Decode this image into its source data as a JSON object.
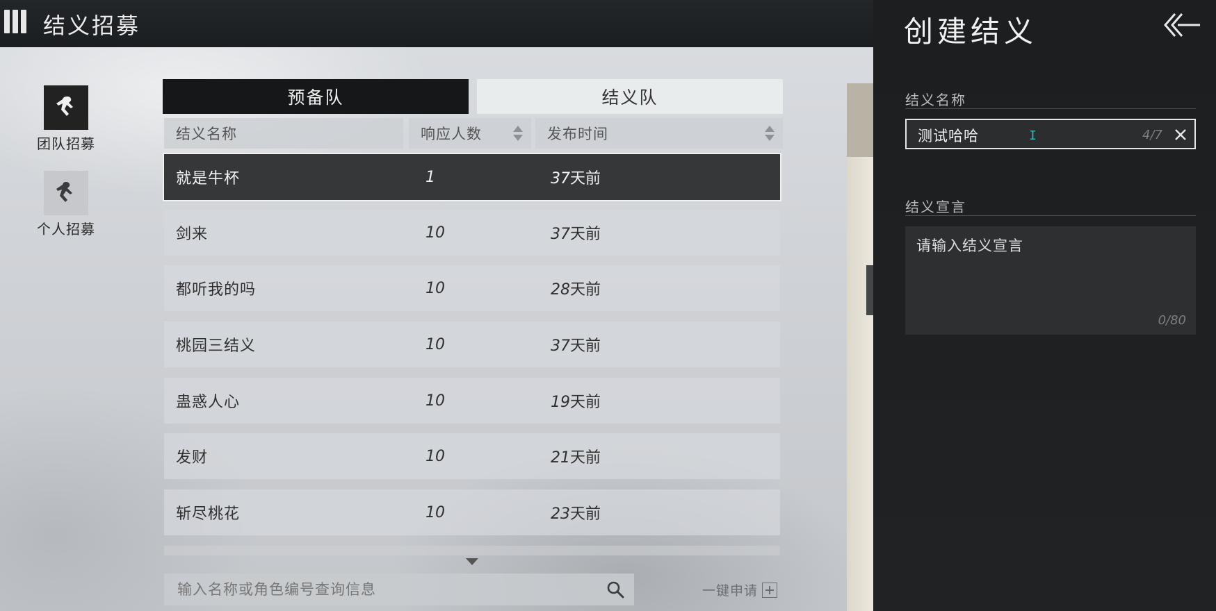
{
  "header": {
    "title": "结义招募"
  },
  "nav": [
    {
      "label": "团队招募",
      "icon": "team-recruit-icon",
      "active": true
    },
    {
      "label": "个人招募",
      "icon": "personal-recruit-icon",
      "active": false
    }
  ],
  "tabs": [
    {
      "label": "预备队",
      "active": true
    },
    {
      "label": "结义队",
      "active": false
    }
  ],
  "columns": {
    "name": "结义名称",
    "count": "响应人数",
    "time": "发布时间"
  },
  "rows": [
    {
      "name": "就是牛杯",
      "count": "1",
      "days": "37",
      "suffix": "天前",
      "selected": true
    },
    {
      "name": "剑来",
      "count": "10",
      "days": "37",
      "suffix": "天前"
    },
    {
      "name": "都听我的吗",
      "count": "10",
      "days": "28",
      "suffix": "天前"
    },
    {
      "name": "桃园三结义",
      "count": "10",
      "days": "37",
      "suffix": "天前"
    },
    {
      "name": "蛊惑人心",
      "count": "10",
      "days": "19",
      "suffix": "天前"
    },
    {
      "name": "发财",
      "count": "10",
      "days": "21",
      "suffix": "天前"
    },
    {
      "name": "斩尽桃花",
      "count": "10",
      "days": "23",
      "suffix": "天前"
    }
  ],
  "search": {
    "placeholder": "输入名称或角色编号查询信息"
  },
  "apply_label": "一键申请",
  "panel": {
    "title": "创建结义",
    "name_label": "结义名称",
    "name_value": "测试哈哈",
    "name_counter": "4/7",
    "declaration_label": "结义宣言",
    "declaration_placeholder": "请输入结义宣言",
    "declaration_counter": "0/80"
  },
  "colors": {
    "selected_row": "#353738",
    "panel_bg": "#1f2123",
    "cursor": "#2fb7b2"
  }
}
